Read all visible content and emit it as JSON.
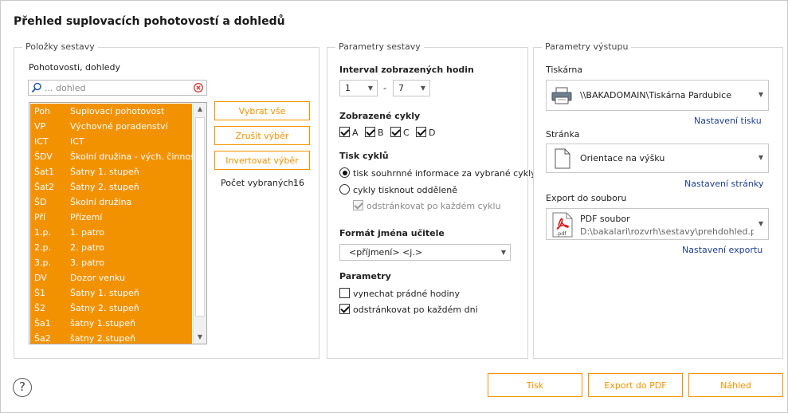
{
  "dialog_title": "Přehled suplovacích pohotovostí a dohledů",
  "items_panel": {
    "legend": "Položky sestavy",
    "list_label": "Pohotovosti, dohledy",
    "search_placeholder": "... dohled",
    "rows": [
      {
        "code": "Poh",
        "name": "Suplovací pohotovost"
      },
      {
        "code": "VP",
        "name": "Výchovné poradenství"
      },
      {
        "code": "ICT",
        "name": "ICT"
      },
      {
        "code": "ŠDV",
        "name": "Školní družina - vých. činnost"
      },
      {
        "code": "Šat1",
        "name": "Šatny 1. stupeň"
      },
      {
        "code": "Šat2",
        "name": "Šatny 2. stupeň"
      },
      {
        "code": "ŠD",
        "name": "Školní družina"
      },
      {
        "code": "Pří",
        "name": "Přízemí"
      },
      {
        "code": "1.p.",
        "name": "1. patro"
      },
      {
        "code": "2.p.",
        "name": "2. patro"
      },
      {
        "code": "3.p.",
        "name": "3. patro"
      },
      {
        "code": "DV",
        "name": "Dozor venku"
      },
      {
        "code": "Š1",
        "name": "Šatny 1. stupeň"
      },
      {
        "code": "Š2",
        "name": "Šatny 2. stupeň"
      },
      {
        "code": "Ša1",
        "name": "šatny 1.stupeň"
      },
      {
        "code": "Ša2",
        "name": "šatny 2.stupeň"
      }
    ],
    "select_all_label": "Vybrat vše",
    "deselect_label": "Zrušit výběr",
    "invert_label": "Invertovat výběr",
    "selected_count_label": "Počet vybraných:",
    "selected_count": "16"
  },
  "params_panel": {
    "legend": "Parametry sestavy",
    "interval_label": "Interval zobrazených hodin",
    "interval_from": "1",
    "interval_separator": "-",
    "interval_to": "7",
    "cycles_label": "Zobrazené cykly",
    "cycles": [
      {
        "label": "A",
        "checked": true
      },
      {
        "label": "B",
        "checked": true
      },
      {
        "label": "C",
        "checked": true
      },
      {
        "label": "D",
        "checked": true
      }
    ],
    "print_cycles_label": "Tisk cyklů",
    "print_summary_label": "tisk souhrnné informace za vybrané cykly",
    "print_separate_label": "cykly tisknout odděleně",
    "page_break_cycle_label": "odstránkovat po každém cyklu",
    "teacher_format_label": "Formát jména učitele",
    "teacher_format_value": "<příjmení> <j.>",
    "parameters_label": "Parametry",
    "skip_empty_label": "vynechat prádné hodiny",
    "page_break_day_label": "odstránkovat po každém dni"
  },
  "output_panel": {
    "legend": "Parametry výstupu",
    "printer_label": "Tiskárna",
    "printer_value": "\\\\BAKADOMAIN\\Tiskárna Pardubice",
    "print_settings_link": "Nastavení tisku",
    "page_label": "Stránka",
    "page_value": "Orientace na výšku",
    "page_settings_link": "Nastavení stránky",
    "export_label": "Export do souboru",
    "export_title": "PDF soubor",
    "export_path": "D:\\bakalari\\rozvrh\\sestavy\\prehdohled.pd",
    "pdf_icon_text": ".pdf",
    "export_settings_link": "Nastavení exportu"
  },
  "footer": {
    "help_glyph": "?",
    "print_label": "Tisk",
    "export_pdf_label": "Export do PDF",
    "preview_label": "Náhled"
  },
  "colors": {
    "accent": "#f39200",
    "link": "#1f3f8f"
  }
}
